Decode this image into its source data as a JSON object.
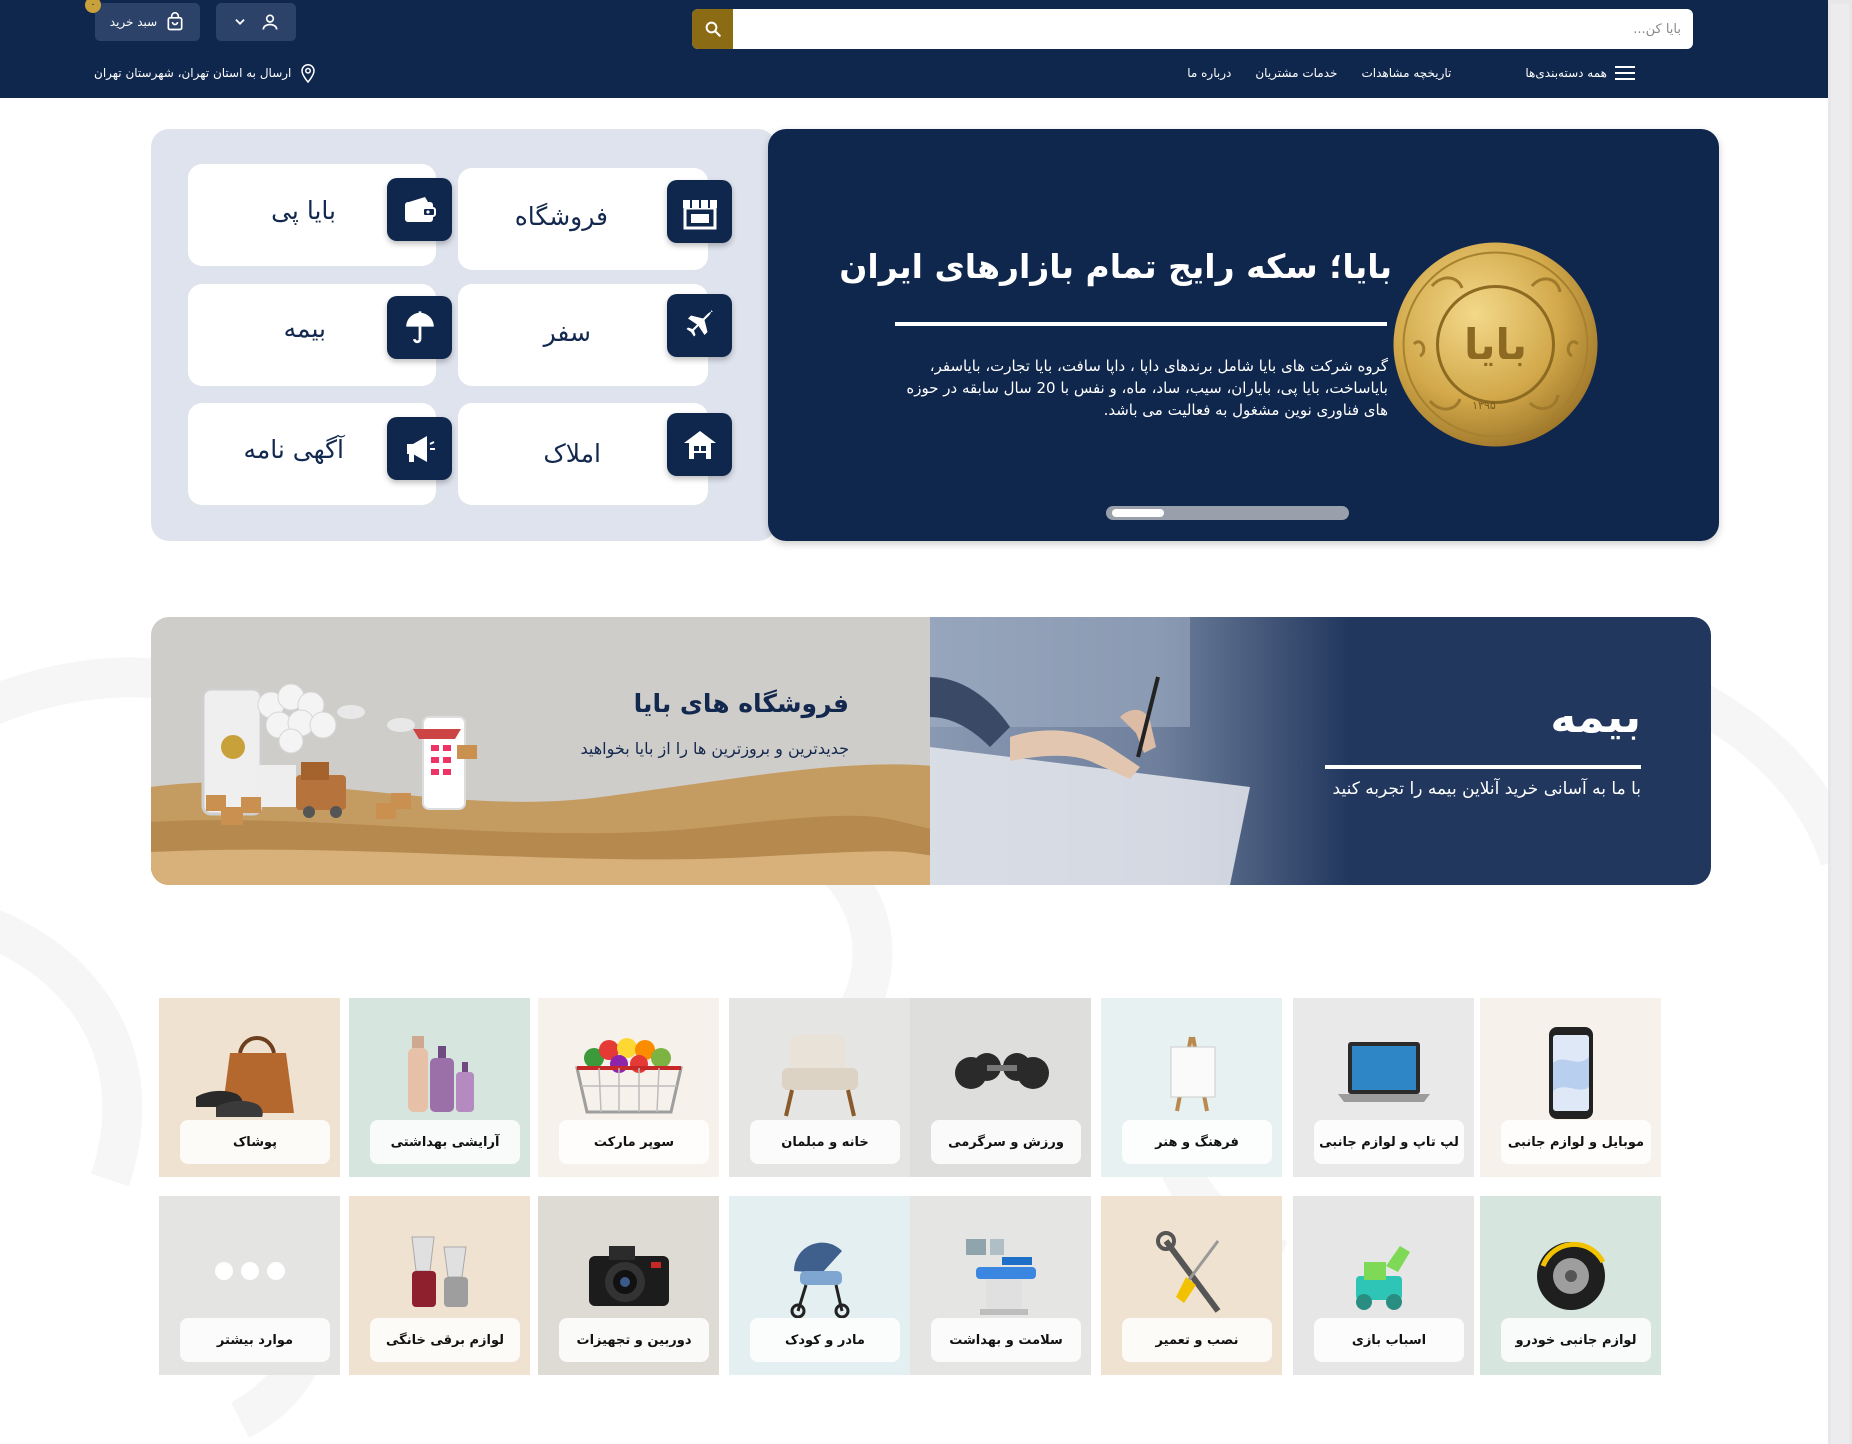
{
  "header": {
    "search": {
      "placeholder": "بایا کن..."
    },
    "cart": {
      "label": "سبد خرید",
      "badge": "۰"
    },
    "nav": {
      "categories_label": "همه دسته‌بندی‌ها",
      "items": [
        "تاریخچه مشاهدات",
        "خدمات مشتریان",
        "درباره ما"
      ]
    },
    "location": "ارسال به استان تهران، شهرستان تهران"
  },
  "services": [
    {
      "label": "فروشگاه",
      "icon": "store-icon"
    },
    {
      "label": "بایا پی",
      "icon": "wallet-icon"
    },
    {
      "label": "سفر",
      "icon": "airplane-icon"
    },
    {
      "label": "بیمه",
      "icon": "umbrella-icon"
    },
    {
      "label": "املاک",
      "icon": "house-icon"
    },
    {
      "label": "آگهی نامه",
      "icon": "megaphone-icon"
    }
  ],
  "hero": {
    "title": "بایا؛ سکه رایج تمام بازارهای ایران",
    "description": "گروه شرکت های بایا شامل برندهای داپا ، داپا سافت، بایا تجارت، بایاسفر، بایاساخت، بایا پی، بایاران، سیب، ساد، ماه، و نفس با 20 سال سابقه در حوزه های فناوری نوین مشغول به فعالیت می باشد.",
    "coin_text": "بایا",
    "coin_year": "۱۳۹۵"
  },
  "banners": {
    "store": {
      "title": "فروشگاه های بایا",
      "subtitle": "جدیدترین و بروزترین ها را از بایا بخواهید"
    },
    "insurance": {
      "title": "بیمه",
      "subtitle": "با ما به آسانی خرید آنلاین بیمه را تجربه کنید"
    }
  },
  "categories_row1": [
    "موبایل و لوازم جانبی",
    "لپ تاپ و لوازم جانبی",
    "فرهنگ و هنر",
    "ورزش و سرگرمی",
    "خانه و مبلمان",
    "سوپر مارکت",
    "آرایشی بهداشتی",
    "پوشاک"
  ],
  "categories_row2": [
    "لوازم جانبی خودرو",
    "اسباب بازی",
    "نصب و تعمیر",
    "سلامت و بهداشت",
    "مادر و کودک",
    "دوربین و تجهیزات",
    "لوازم برقی خانگی",
    "موارد بیشتر"
  ],
  "colors": {
    "navy": "#0f264d",
    "gold": "#8b6b14",
    "panel": "#dfe3ed"
  }
}
